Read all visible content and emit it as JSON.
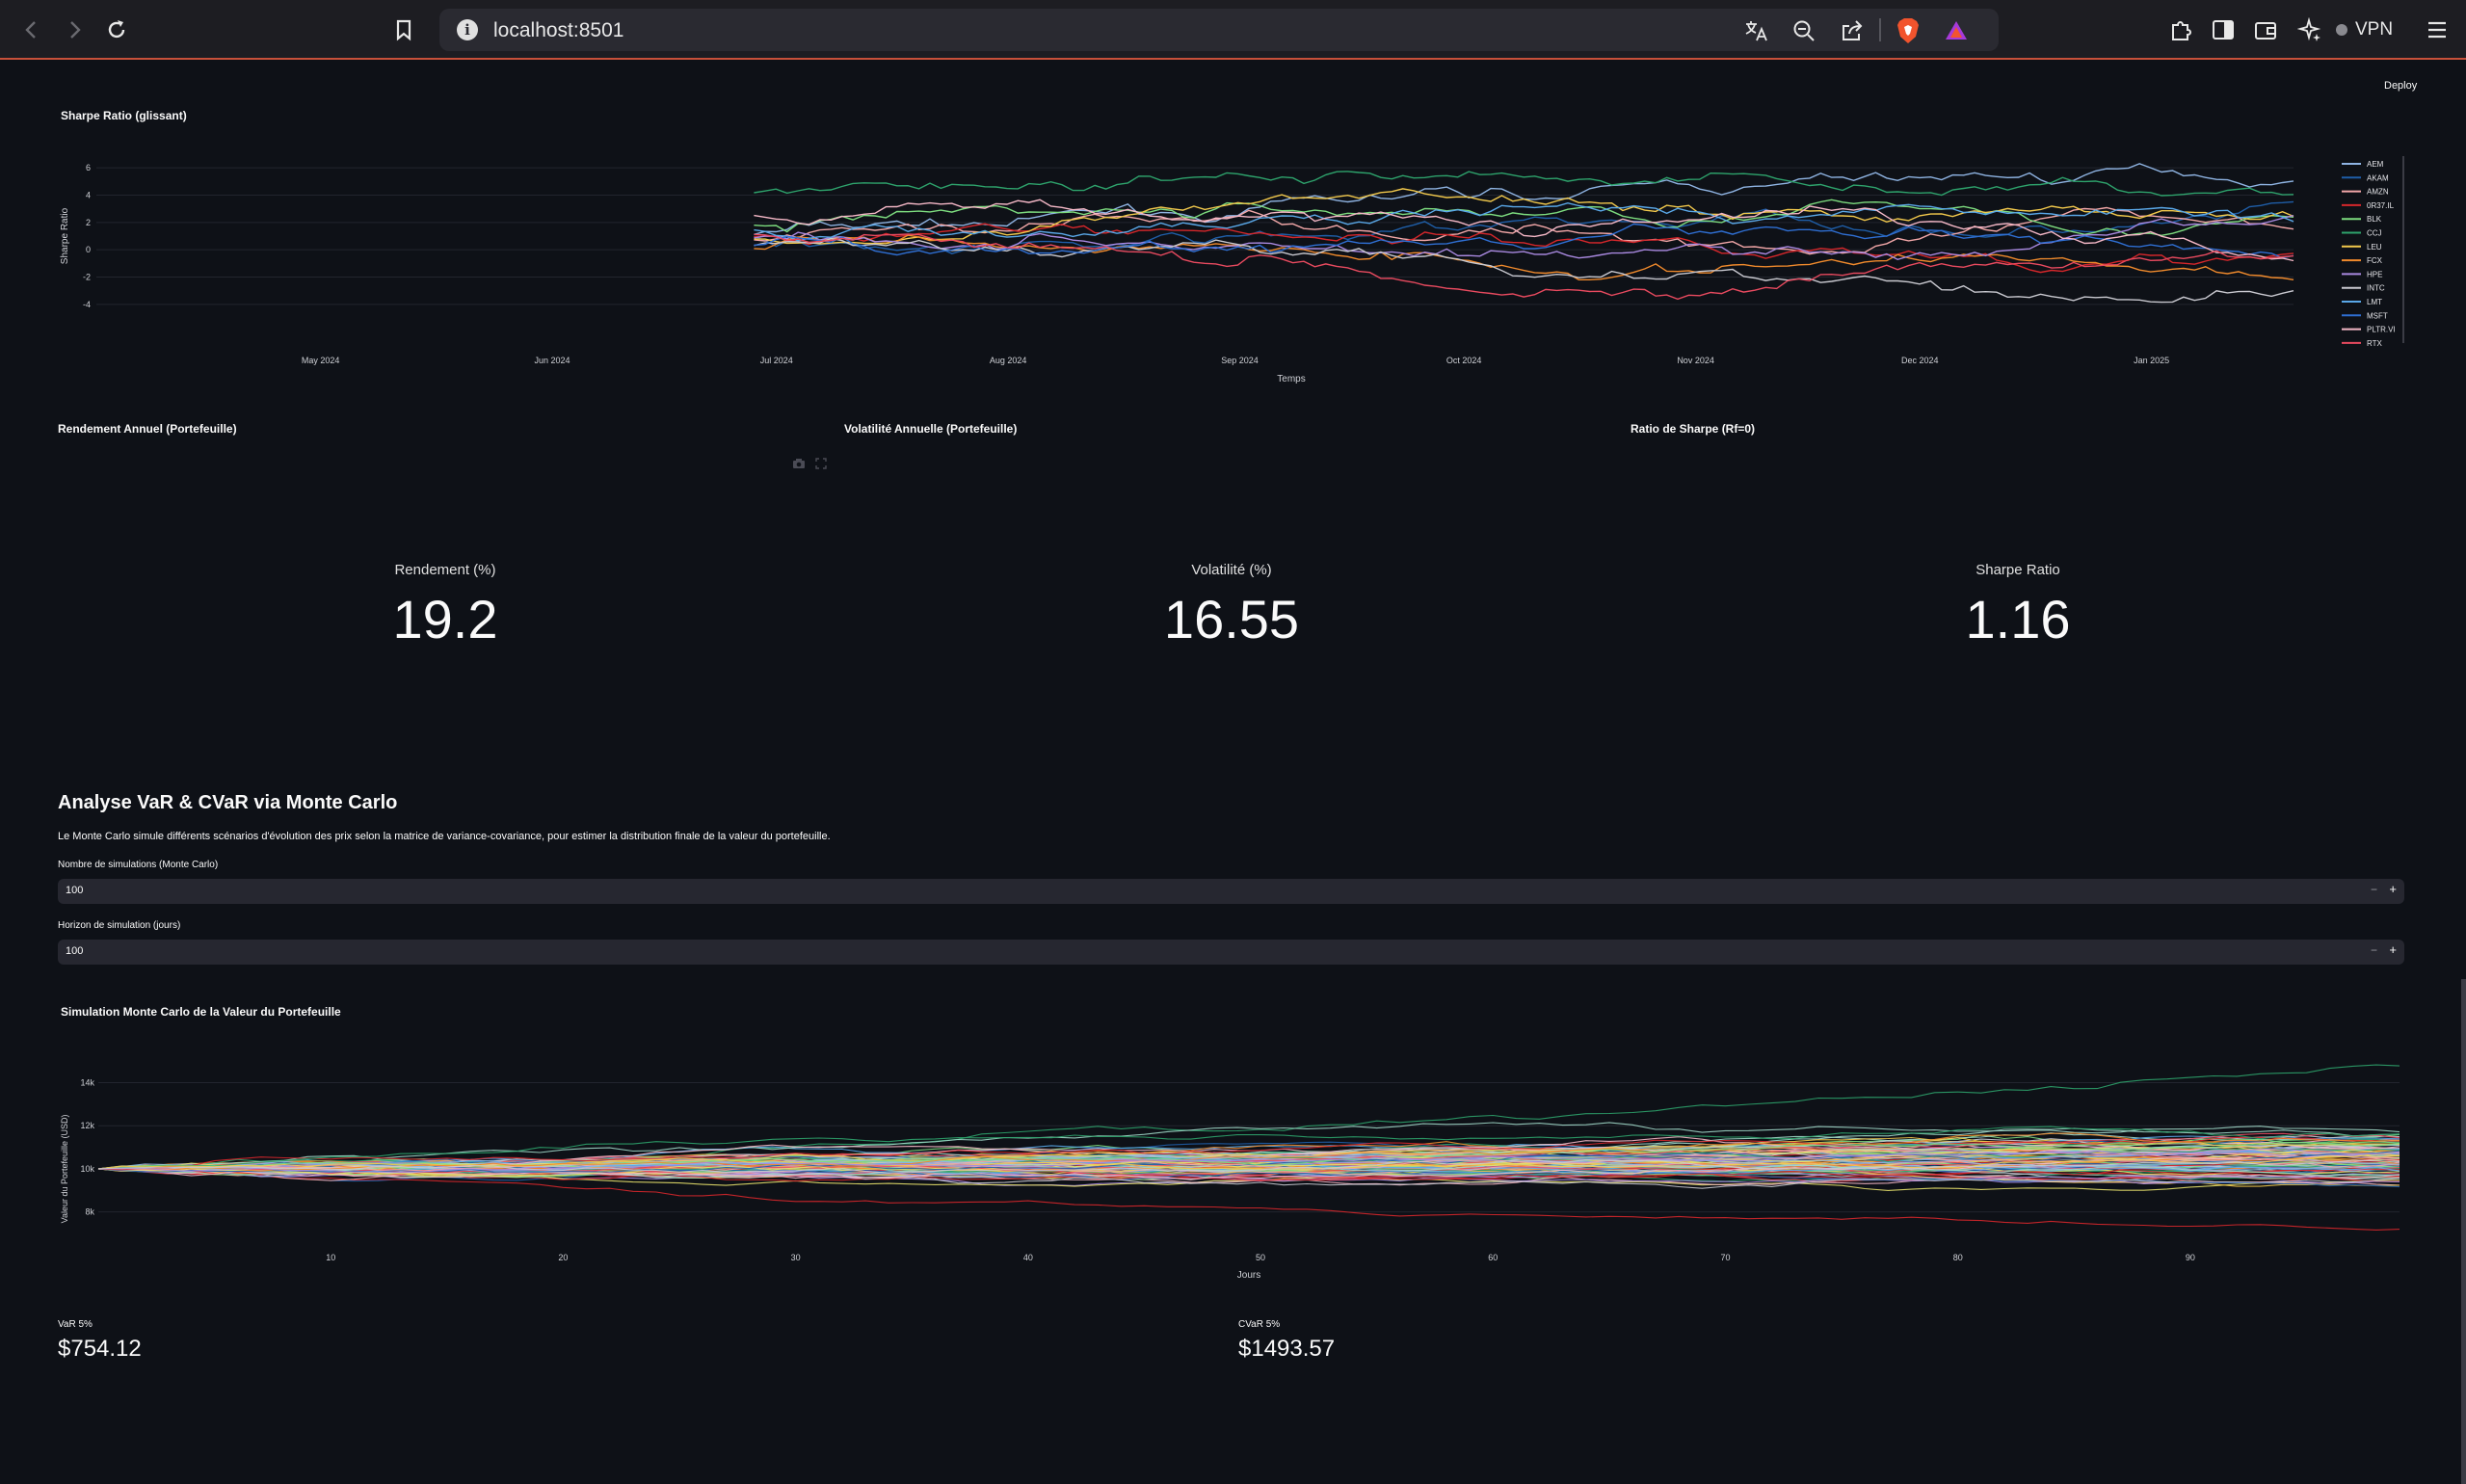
{
  "browser": {
    "url": "localhost:8501",
    "vpn_label": "VPN",
    "info_glyph": "i"
  },
  "app": {
    "deploy_label": "Deploy"
  },
  "sharpe_chart": {
    "title": "Sharpe Ratio (glissant)",
    "chart_data": {
      "type": "line",
      "title": "Sharpe Ratio (glissant)",
      "xlabel": "Temps",
      "ylabel": "Sharpe Ratio",
      "ylim": [
        -5,
        7
      ],
      "yticks": [
        6,
        4,
        2,
        0,
        -2,
        -4
      ],
      "xticks": [
        "May 2024",
        "Jun 2024",
        "Jul 2024",
        "Aug 2024",
        "Sep 2024",
        "Oct 2024",
        "Nov 2024",
        "Dec 2024",
        "Jan 2025"
      ],
      "x_range": [
        "2024-04-01",
        "2025-01-20"
      ],
      "data_start": "2024-06-28",
      "legend_position": "right",
      "series": [
        {
          "name": "AEM",
          "color": "#8fb4e3"
        },
        {
          "name": "AKAM",
          "color": "#1f5ea8"
        },
        {
          "name": "AMZN",
          "color": "#f2a7a8"
        },
        {
          "name": "0R37.IL",
          "color": "#d6272b"
        },
        {
          "name": "BLK",
          "color": "#7ddc7f"
        },
        {
          "name": "CCJ",
          "color": "#2ea36c"
        },
        {
          "name": "LEU",
          "color": "#f2c94c"
        },
        {
          "name": "FCX",
          "color": "#f08a2c"
        },
        {
          "name": "HPE",
          "color": "#a989e0"
        },
        {
          "name": "INTC",
          "color": "#c9c9d0"
        },
        {
          "name": "LMT",
          "color": "#5aa8e8"
        },
        {
          "name": "MSFT",
          "color": "#2f6fd3"
        },
        {
          "name": "PLTR.VI",
          "color": "#f5b8c7"
        },
        {
          "name": "RTX",
          "color": "#e84a5f"
        }
      ]
    }
  },
  "metrics": {
    "return": {
      "section": "Rendement Annuel (Portefeuille)",
      "label": "Rendement (%)",
      "value": "19.2"
    },
    "volatility": {
      "section": "Volatilité Annuelle (Portefeuille)",
      "label": "Volatilité (%)",
      "value": "16.55"
    },
    "sharpe": {
      "section": "Ratio de Sharpe (Rf=0)",
      "label": "Sharpe Ratio",
      "value": "1.16"
    }
  },
  "montecarlo": {
    "title": "Analyse VaR & CVaR via Monte Carlo",
    "description": "Le Monte Carlo simule différents scénarios d'évolution des prix selon la matrice de variance-covariance, pour estimer la distribution finale de la valeur du portefeuille.",
    "sims_label": "Nombre de simulations (Monte Carlo)",
    "sims_value": "100",
    "horizon_label": "Horizon de simulation (jours)",
    "horizon_value": "100",
    "minus": "−",
    "plus": "+",
    "chart": {
      "title": "Simulation Monte Carlo de la Valeur du Portefeuille",
      "chart_data": {
        "type": "line",
        "title": "Simulation Monte Carlo de la Valeur du Portefeuille",
        "xlabel": "Jours",
        "ylabel": "Valeur du Portefeuille (USD)",
        "xlim": [
          0,
          99
        ],
        "ylim": [
          7000,
          15500
        ],
        "xticks": [
          10,
          20,
          30,
          40,
          50,
          60,
          70,
          80,
          90
        ],
        "yticks": [
          {
            "value": 14000,
            "label": "14k"
          },
          {
            "value": 12000,
            "label": "12k"
          },
          {
            "value": 10000,
            "label": "10k"
          },
          {
            "value": 8000,
            "label": "8k"
          }
        ],
        "n_paths": 100,
        "start_value": 10000,
        "end_range": [
          6700,
          15100
        ]
      }
    },
    "var_label": "VaR 5%",
    "var_value": "$754.12",
    "cvar_label": "CVaR 5%",
    "cvar_value": "$1493.57"
  }
}
